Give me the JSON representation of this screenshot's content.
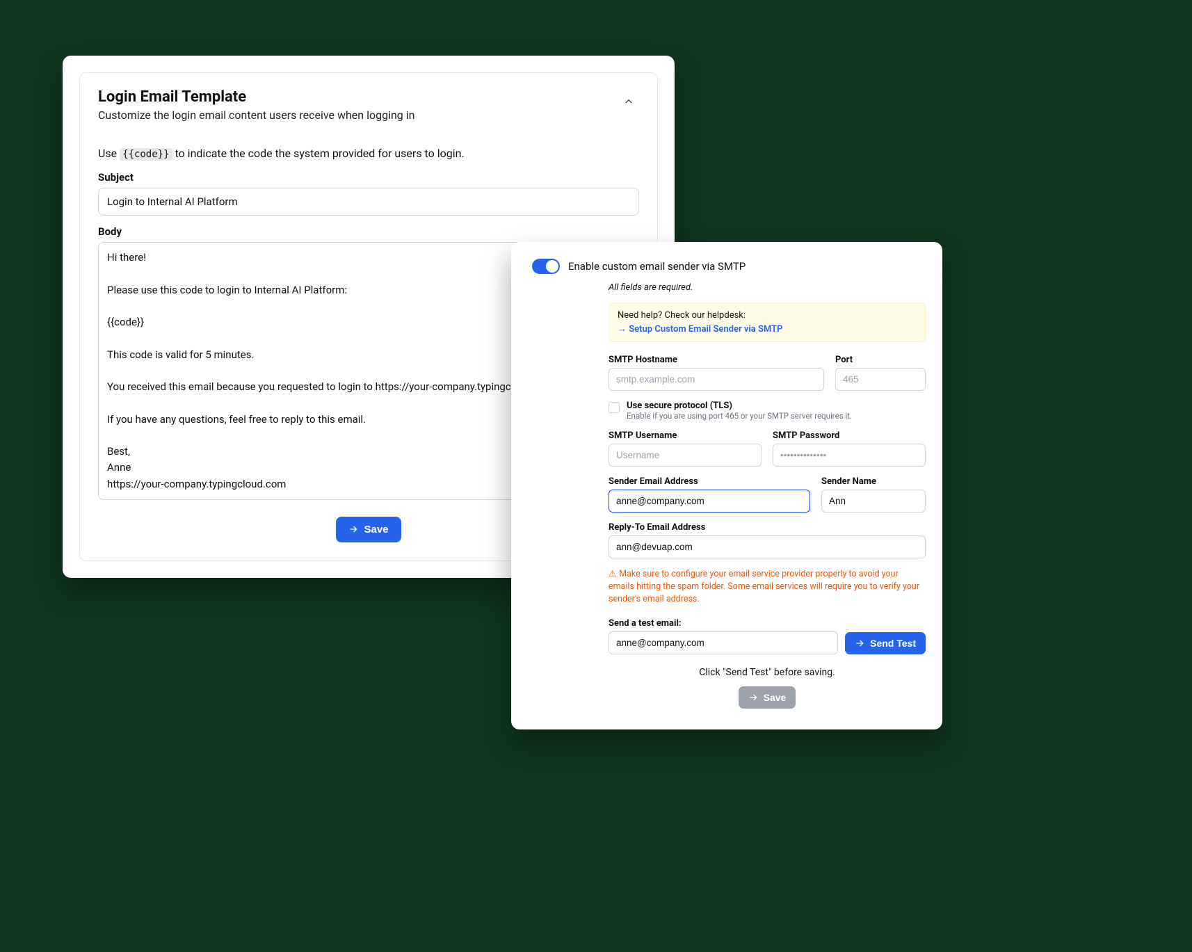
{
  "left": {
    "title": "Login Email Template",
    "subtitle": "Customize the login email content users receive when logging in",
    "hint_prefix": "Use ",
    "hint_code": "{{code}}",
    "hint_suffix": " to indicate the code the system provided for users to login.",
    "subject_label": "Subject",
    "subject_value": "Login to Internal AI Platform",
    "body_label": "Body",
    "body_value": "Hi there!\n\nPlease use this code to login to Internal AI Platform:\n\n{{code}}\n\nThis code is valid for 5 minutes.\n\nYou received this email because you requested to login to https://your-company.typingcloud.com.\n\nIf you have any questions, feel free to reply to this email.\n\nBest,\nAnne\nhttps://your-company.typingcloud.com",
    "save_label": "Save"
  },
  "right": {
    "toggle_label": "Enable custom email sender via SMTP",
    "required_note": "All fields are required.",
    "help_text": "Need help? Check our helpdesk:",
    "help_link": "→ Setup Custom Email Sender via SMTP",
    "hostname_label": "SMTP Hostname",
    "hostname_placeholder": "smtp.example.com",
    "port_label": "Port",
    "port_placeholder": "465",
    "tls_label": "Use secure protocol (TLS)",
    "tls_sub": "Enable if you are using port 465 or your SMTP server requires it.",
    "username_label": "SMTP Username",
    "username_placeholder": "Username",
    "password_label": "SMTP Password",
    "password_placeholder": "••••••••••••••",
    "sender_email_label": "Sender Email Address",
    "sender_email_value": "anne@company.com",
    "sender_name_label": "Sender Name",
    "sender_name_value": "Ann",
    "reply_to_label": "Reply-To Email Address",
    "reply_to_value": "ann@devuap.com",
    "warning": "Make sure to configure your email service provider properly to avoid your emails hitting the spam folder. Some email services will require you to verify your sender's email address.",
    "test_label": "Send a test email:",
    "test_value": "anne@company.com",
    "send_test_label": "Send Test",
    "save_hint": "Click \"Send Test\" before saving.",
    "save_label": "Save"
  }
}
